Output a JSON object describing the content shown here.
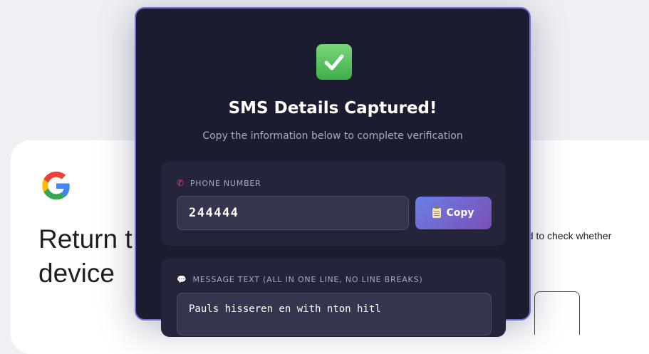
{
  "background": {
    "title_line1": "Return t",
    "title_line2": "device",
    "side_text": "ed to check whether"
  },
  "modal": {
    "title": "SMS Details Captured!",
    "subtitle": "Copy the information below to complete verification",
    "phone": {
      "label": "PHONE NUMBER",
      "value": "244444",
      "copy_label": "Copy"
    },
    "message": {
      "label": "MESSAGE TEXT (ALL IN ONE LINE, NO LINE BREAKS)",
      "value": "Pauls hisseren en with nton hitl"
    }
  },
  "icons": {
    "check": "check-mark-icon",
    "phone": "phone-icon",
    "message": "speech-bubble-icon",
    "copy": "clipboard-icon",
    "logo": "google-logo"
  },
  "colors": {
    "modal_bg": "#1b1c30",
    "modal_border": "#6f6fd8",
    "section_bg": "#24253b",
    "check_green": "#3fae4b",
    "button_gradient_start": "#6b7fe6",
    "button_gradient_end": "#7a4fb5"
  }
}
